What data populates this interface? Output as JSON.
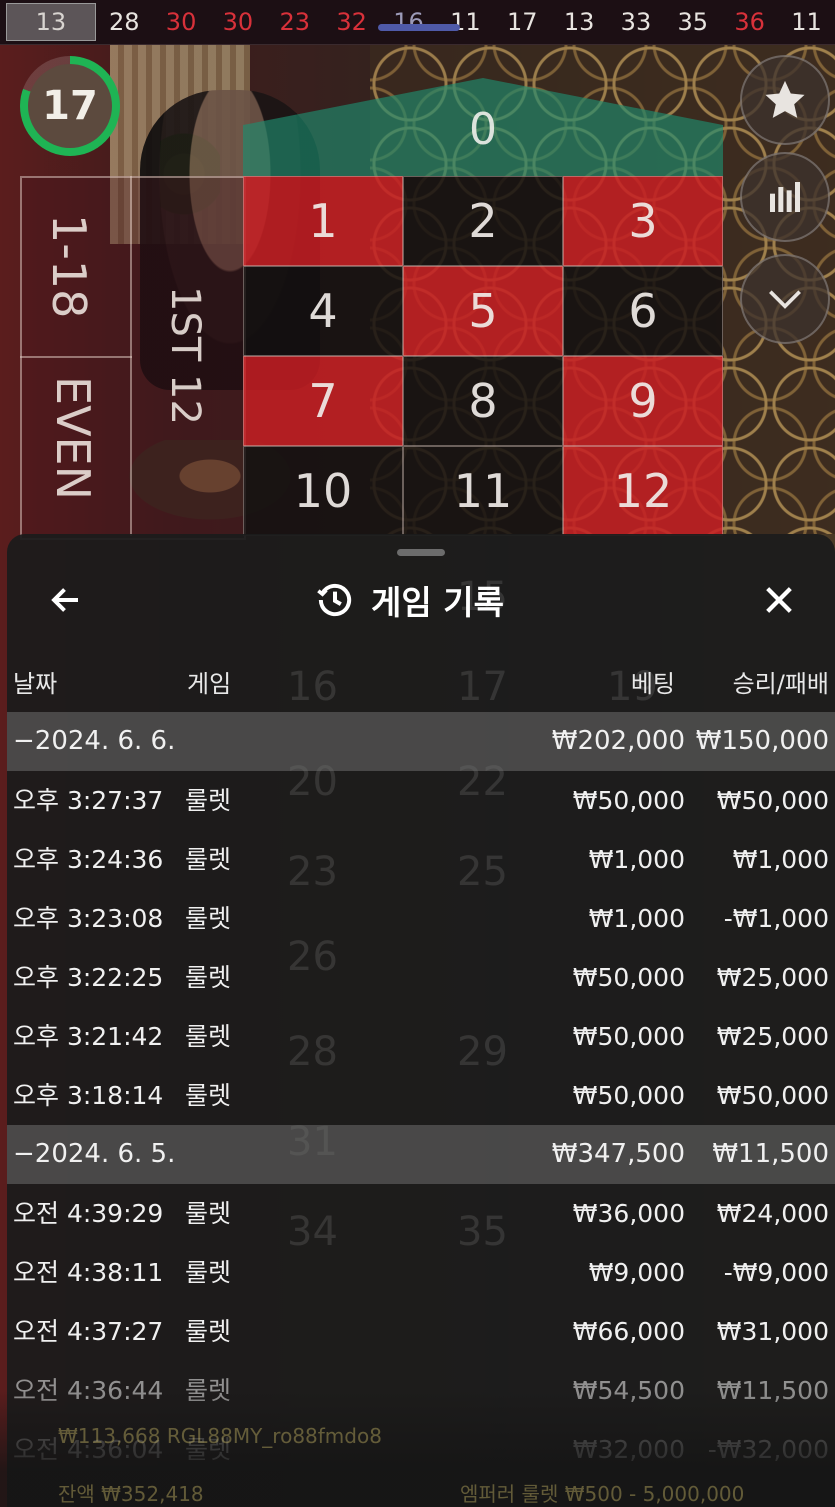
{
  "results_bar": {
    "numbers": [
      {
        "value": "13",
        "color": "first"
      },
      {
        "value": "28",
        "color": "white"
      },
      {
        "value": "30",
        "color": "red"
      },
      {
        "value": "30",
        "color": "red"
      },
      {
        "value": "23",
        "color": "red"
      },
      {
        "value": "32",
        "color": "red"
      },
      {
        "value": "16",
        "color": "dim"
      },
      {
        "value": "11",
        "color": "white"
      },
      {
        "value": "17",
        "color": "white"
      },
      {
        "value": "13",
        "color": "white"
      },
      {
        "value": "33",
        "color": "white"
      },
      {
        "value": "35",
        "color": "white"
      },
      {
        "value": "36",
        "color": "red"
      },
      {
        "value": "11",
        "color": "white"
      }
    ]
  },
  "timer": {
    "value": "17",
    "progress_percent": 80
  },
  "table": {
    "zero": "0",
    "numbers": [
      {
        "n": "1",
        "color": "red"
      },
      {
        "n": "2",
        "color": "black"
      },
      {
        "n": "3",
        "color": "red"
      },
      {
        "n": "4",
        "color": "black"
      },
      {
        "n": "5",
        "color": "red"
      },
      {
        "n": "6",
        "color": "black"
      },
      {
        "n": "7",
        "color": "red"
      },
      {
        "n": "8",
        "color": "black"
      },
      {
        "n": "9",
        "color": "red"
      },
      {
        "n": "10",
        "color": "black"
      },
      {
        "n": "11",
        "color": "black"
      },
      {
        "n": "12",
        "color": "red"
      }
    ],
    "side_low": "1-18",
    "side_even": "EVEN",
    "dozen": "1ST 12",
    "ghost_numbers": [
      "15",
      "16",
      "17",
      "19",
      "20",
      "22",
      "23",
      "25",
      "26",
      "28",
      "29",
      "31",
      "34",
      "35"
    ]
  },
  "right_buttons": [
    {
      "icon": "star-icon"
    },
    {
      "icon": "stats-icon"
    },
    {
      "icon": "chevron-down-icon"
    }
  ],
  "history": {
    "title": "게임 기록",
    "columns": {
      "date": "날짜",
      "game": "게임",
      "bet": "베팅",
      "result": "승리/패배"
    },
    "rows": [
      {
        "type": "group",
        "time": "−2024. 6. 6.",
        "game": "",
        "bet": "₩202,000",
        "result": "₩150,000"
      },
      {
        "type": "item",
        "time": "오후 3:27:37",
        "game": "룰렛",
        "bet": "₩50,000",
        "result": "₩50,000"
      },
      {
        "type": "item",
        "time": "오후 3:24:36",
        "game": "룰렛",
        "bet": "₩1,000",
        "result": "₩1,000"
      },
      {
        "type": "item",
        "time": "오후 3:23:08",
        "game": "룰렛",
        "bet": "₩1,000",
        "result": "-₩1,000"
      },
      {
        "type": "item",
        "time": "오후 3:22:25",
        "game": "룰렛",
        "bet": "₩50,000",
        "result": "₩25,000"
      },
      {
        "type": "item",
        "time": "오후 3:21:42",
        "game": "룰렛",
        "bet": "₩50,000",
        "result": "₩25,000"
      },
      {
        "type": "item",
        "time": "오후 3:18:14",
        "game": "룰렛",
        "bet": "₩50,000",
        "result": "₩50,000"
      },
      {
        "type": "group",
        "time": "−2024. 6. 5.",
        "game": "",
        "bet": "₩347,500",
        "result": "₩11,500"
      },
      {
        "type": "item",
        "time": "오전 4:39:29",
        "game": "룰렛",
        "bet": "₩36,000",
        "result": "₩24,000"
      },
      {
        "type": "item",
        "time": "오전 4:38:11",
        "game": "룰렛",
        "bet": "₩9,000",
        "result": "-₩9,000"
      },
      {
        "type": "item",
        "time": "오전 4:37:27",
        "game": "룰렛",
        "bet": "₩66,000",
        "result": "₩31,000"
      },
      {
        "type": "faded",
        "time": "오전 4:36:44",
        "game": "룰렛",
        "bet": "₩54,500",
        "result": "₩11,500"
      },
      {
        "type": "faded2",
        "time": "오전 4:36:04",
        "game": "룰렛",
        "bet": "₩32,000",
        "result": "-₩32,000"
      }
    ]
  },
  "footer_ghost": {
    "player_line": "₩113,668 RGL88MY_ro88fmdo8",
    "bet_line": "잔액 ₩352,418",
    "table_limits": "엠퍼러 룰렛 ₩500 - 5,000,000"
  },
  "colors": {
    "red": "#c81e23",
    "zero_green": "#1e8c6e",
    "timer_green": "#1fb454",
    "sheet_bg": "#1c1c1c"
  }
}
